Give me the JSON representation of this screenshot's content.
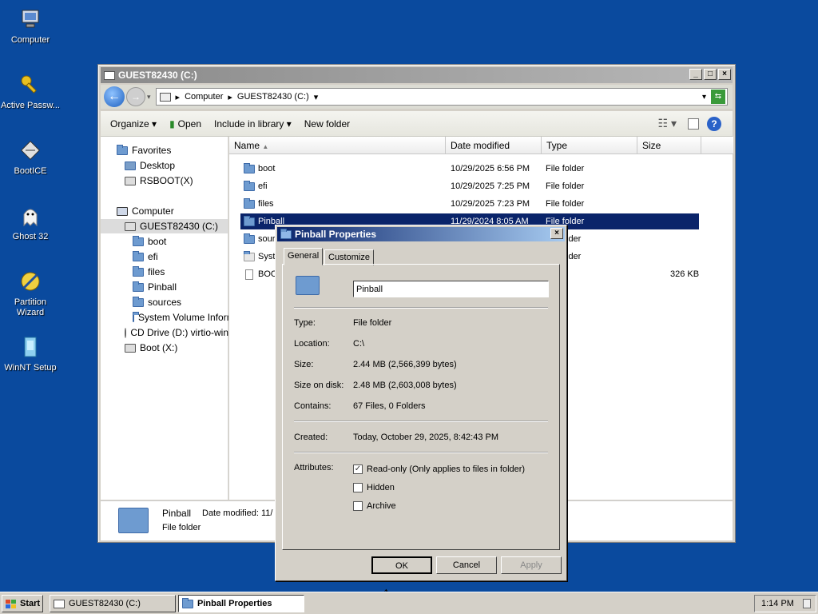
{
  "desktop": {
    "icons": [
      {
        "label": "Computer",
        "icon": "computer-icon"
      },
      {
        "label": "Active Passw...",
        "icon": "key-icon"
      },
      {
        "label": "BootICE",
        "icon": "bootice-icon"
      },
      {
        "label": "Ghost 32",
        "icon": "ghost-icon"
      },
      {
        "label": "Partition Wizard",
        "icon": "partition-wizard-icon"
      },
      {
        "label": "WinNT Setup",
        "icon": "winnt-setup-icon"
      }
    ]
  },
  "explorer": {
    "title": "GUEST82430 (C:)",
    "breadcrumb": [
      "Computer",
      "GUEST82430 (C:)"
    ],
    "toolbar": {
      "organize": "Organize",
      "open": "Open",
      "include": "Include in library",
      "new_folder": "New folder"
    },
    "nav": {
      "favorites": "Favorites",
      "desktop": "Desktop",
      "rsboot": "RSBOOT(X)",
      "computer": "Computer",
      "drive_c": "GUEST82430 (C:)",
      "folders": [
        "boot",
        "efi",
        "files",
        "Pinball",
        "sources",
        "System Volume Information"
      ],
      "cd_drive": "CD Drive (D:) virtio-win",
      "boot_x": "Boot (X:)"
    },
    "columns": [
      "Name",
      "Date modified",
      "Type",
      "Size"
    ],
    "rows": [
      {
        "name": "boot",
        "date": "10/29/2025 6:56 PM",
        "type": "File folder",
        "size": ""
      },
      {
        "name": "efi",
        "date": "10/29/2025 7:25 PM",
        "type": "File folder",
        "size": ""
      },
      {
        "name": "files",
        "date": "10/29/2025 7:23 PM",
        "type": "File folder",
        "size": ""
      },
      {
        "name": "Pinball",
        "date": "11/29/2024 8:05 AM",
        "type": "File folder",
        "size": ""
      },
      {
        "name": "sour",
        "date": "",
        "type": "lder",
        "size": ""
      },
      {
        "name": "Syst",
        "date": "",
        "type": "lder",
        "size": ""
      },
      {
        "name": "BOO",
        "date": "",
        "type": "",
        "size": "326 KB"
      }
    ],
    "details": {
      "name": "Pinball",
      "date_label": "Date modified:  11/",
      "type": "File folder"
    }
  },
  "dialog": {
    "title": "Pinball Properties",
    "tabs": [
      "General",
      "Customize"
    ],
    "folder_name": "Pinball",
    "fields": [
      {
        "label": "Type:",
        "value": "File folder"
      },
      {
        "label": "Location:",
        "value": "C:\\"
      },
      {
        "label": "Size:",
        "value": "2.44 MB (2,566,399 bytes)"
      },
      {
        "label": "Size on disk:",
        "value": "2.48 MB (2,603,008 bytes)"
      },
      {
        "label": "Contains:",
        "value": "67 Files, 0 Folders"
      }
    ],
    "created_label": "Created:",
    "created_value": "Today, October 29, 2025, 8:42:43 PM",
    "attributes_label": "Attributes:",
    "attributes": [
      {
        "label": "Read-only (Only applies to files in folder)",
        "checked": true
      },
      {
        "label": "Hidden",
        "checked": false
      },
      {
        "label": "Archive",
        "checked": false
      }
    ],
    "buttons": {
      "ok": "OK",
      "cancel": "Cancel",
      "apply": "Apply"
    }
  },
  "taskbar": {
    "start": "Start",
    "tasks": [
      "GUEST82430 (C:)",
      "Pinball Properties"
    ],
    "clock": "1:14 PM"
  },
  "colors": {
    "desktop": "#0a4a9e",
    "selection": "#0a246a",
    "titlebar_active": "#0a246a"
  }
}
